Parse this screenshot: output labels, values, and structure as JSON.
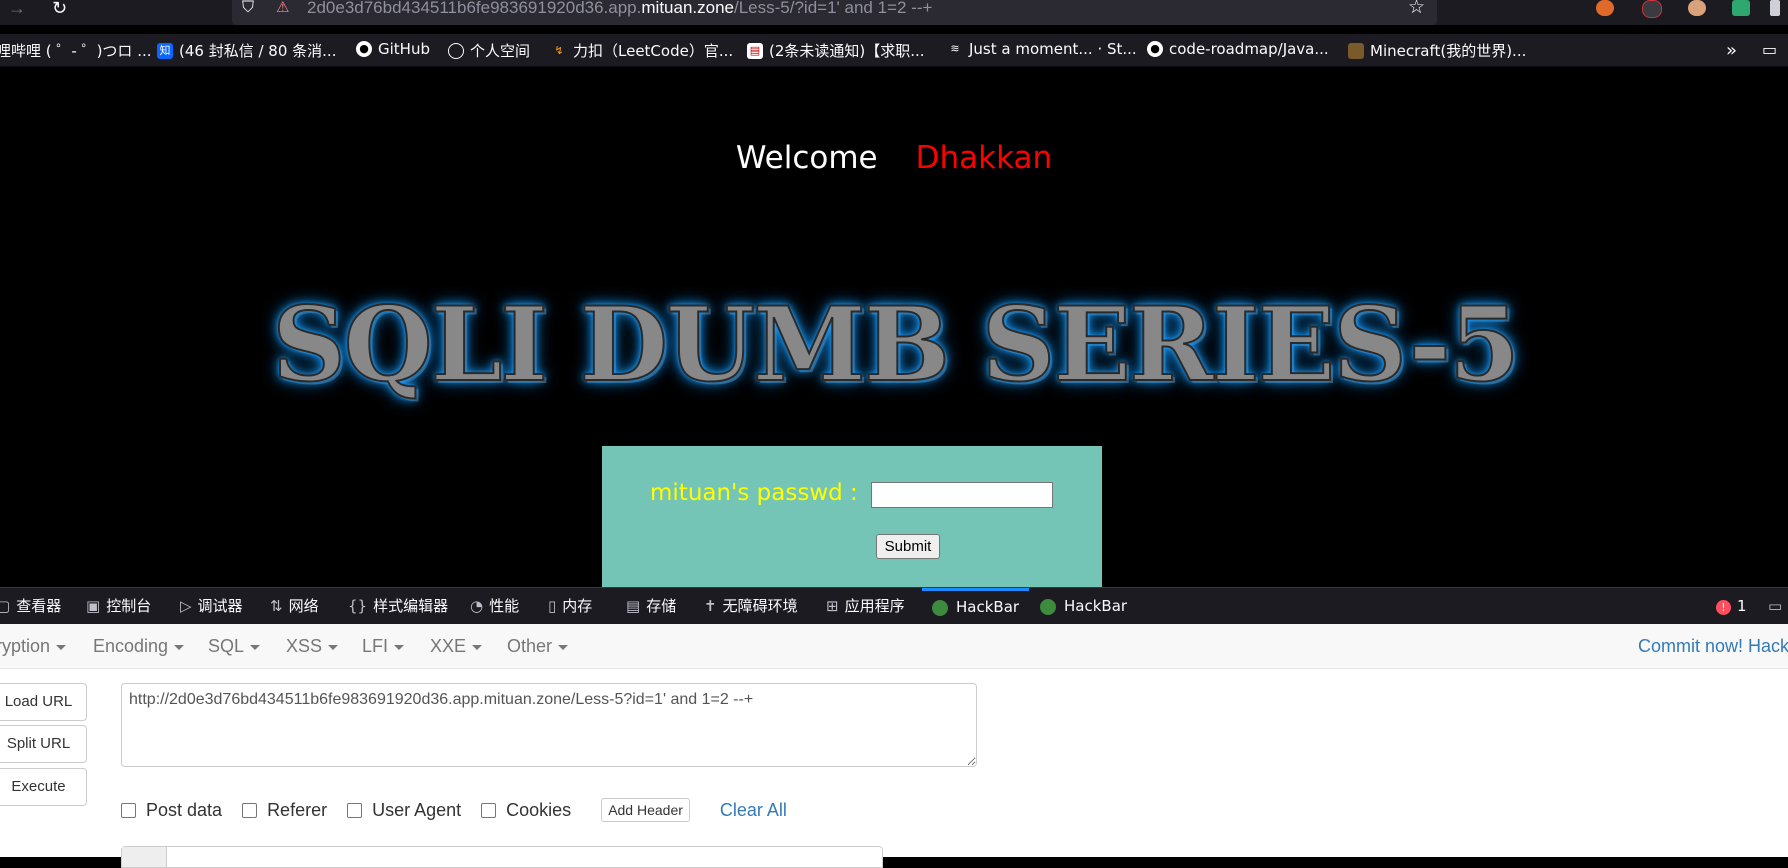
{
  "browser": {
    "url_prefix": "2d0e3d76bd434511b6fe983691920d36.app.",
    "url_domain": "mituan.zone",
    "url_suffix": "/Less-5/?id=1' and 1=2 --+"
  },
  "bookmarks": [
    {
      "label": "哩哔哩 ( ゜- ゜)つロ ...",
      "icon": "bilibili-icon"
    },
    {
      "label": "(46 封私信 / 80 条消...",
      "icon": "zhihu-icon"
    },
    {
      "label": "GitHub",
      "icon": "github-icon"
    },
    {
      "label": "个人空间",
      "icon": "globe-icon"
    },
    {
      "label": "力扣（LeetCode）官...",
      "icon": "leetcode-icon"
    },
    {
      "label": "(2条未读通知)【求职...",
      "icon": "notify-icon"
    },
    {
      "label": "Just a moment... · St...",
      "icon": "stack-icon"
    },
    {
      "label": "code-roadmap/Java...",
      "icon": "github-icon"
    },
    {
      "label": "Minecraft(我的世界)...",
      "icon": "minecraft-icon"
    }
  ],
  "page": {
    "welcome": "Welcome",
    "name": "Dhakkan",
    "title": "SQLI DUMB SERIES-5",
    "password_label": "mituan's passwd :",
    "submit_label": "Submit"
  },
  "devtools": {
    "tabs": [
      {
        "label": "查看器",
        "icon": "inspector-icon"
      },
      {
        "label": "控制台",
        "icon": "console-icon"
      },
      {
        "label": "调试器",
        "icon": "debugger-icon"
      },
      {
        "label": "网络",
        "icon": "network-icon"
      },
      {
        "label": "样式编辑器",
        "icon": "style-editor-icon"
      },
      {
        "label": "性能",
        "icon": "performance-icon"
      },
      {
        "label": "内存",
        "icon": "memory-icon"
      },
      {
        "label": "存储",
        "icon": "storage-icon"
      },
      {
        "label": "无障碍环境",
        "icon": "accessibility-icon"
      },
      {
        "label": "应用程序",
        "icon": "application-icon"
      },
      {
        "label": "HackBar",
        "icon": "hackbar-icon",
        "active": true
      },
      {
        "label": "HackBar",
        "icon": "hackbar-icon"
      }
    ],
    "error_count": "1"
  },
  "hackbar": {
    "menu": [
      "ryption",
      "Encoding",
      "SQL",
      "XSS",
      "LFI",
      "XXE",
      "Other"
    ],
    "commit_text": "Commit now!",
    "commit_trail": "Hackl",
    "load_url": "Load URL",
    "split_url": "Split URL",
    "execute": "Execute",
    "url_value": "http://2d0e3d76bd434511b6fe983691920d36.app.mituan.zone/Less-5?id=1' and 1=2 --+",
    "options": [
      "Post data",
      "Referer",
      "User Agent",
      "Cookies"
    ],
    "add_header": "Add Header",
    "clear_all": "Clear All"
  }
}
